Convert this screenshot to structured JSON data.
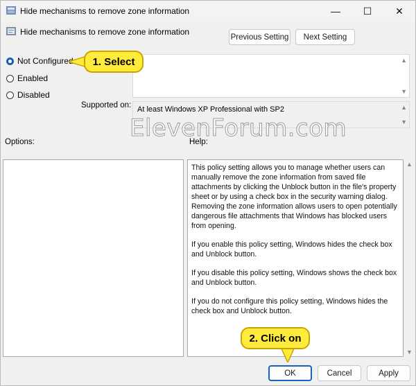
{
  "window": {
    "title": "Hide mechanisms to remove zone information",
    "controls": {
      "minimize": "—",
      "maximize": "☐",
      "close": "✕"
    }
  },
  "header": {
    "policy_name": "Hide mechanisms to remove zone information",
    "previous_button": "Previous Setting",
    "next_button": "Next Setting"
  },
  "state": {
    "options": [
      {
        "label": "Not Configured",
        "checked": true
      },
      {
        "label": "Enabled",
        "checked": false
      },
      {
        "label": "Disabled",
        "checked": false
      }
    ]
  },
  "supported_on": {
    "label": "Supported on:",
    "value": "At least Windows XP Professional with SP2"
  },
  "panes": {
    "options_label": "Options:",
    "help_label": "Help:",
    "help_paragraphs": [
      "This policy setting allows you to manage whether users can manually remove the zone information from saved file attachments by clicking the Unblock button in the file's property sheet or by using a check box in the security warning dialog. Removing the zone information allows users to open potentially dangerous file attachments that Windows has blocked users from opening.",
      "If you enable this policy setting, Windows hides the check box and Unblock button.",
      "If you disable this policy setting, Windows shows the check box and Unblock button.",
      "If you do not configure this policy setting, Windows hides the check box and Unblock button."
    ]
  },
  "footer": {
    "ok": "OK",
    "cancel": "Cancel",
    "apply": "Apply"
  },
  "annotations": {
    "step1": "1. Select",
    "step2": "2. Click on"
  },
  "watermark": "ElevenForum.com",
  "colors": {
    "accent": "#1a5fb4",
    "callout": "#ffeb3b"
  }
}
